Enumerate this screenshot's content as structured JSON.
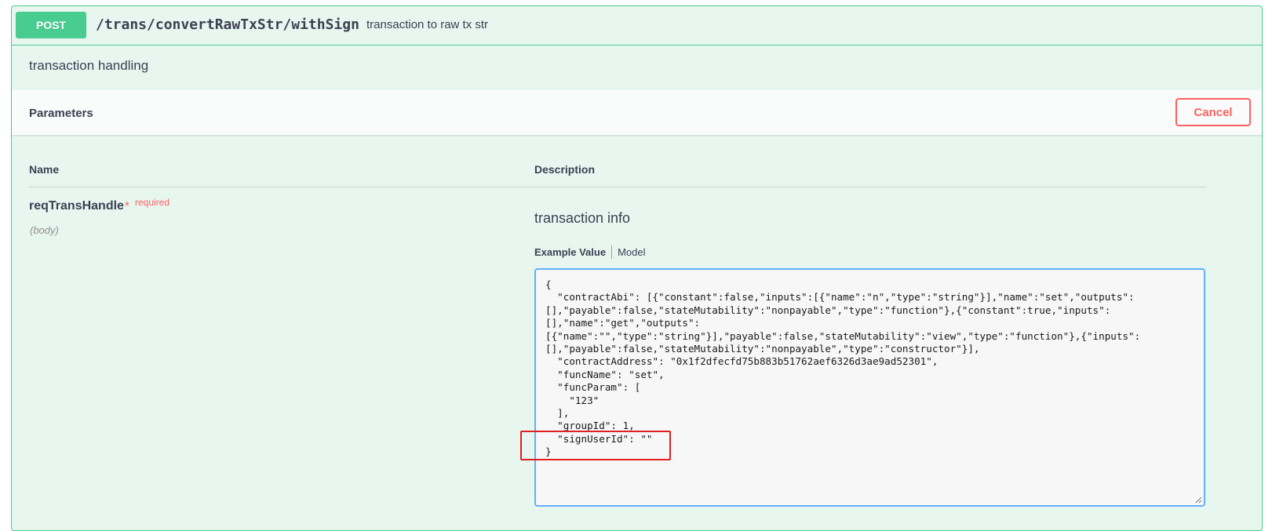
{
  "operation": {
    "method": "POST",
    "path": "/trans/convertRawTxStr/withSign",
    "summary": "transaction to raw tx str",
    "description": "transaction handling"
  },
  "parameters": {
    "title": "Parameters",
    "cancel_label": "Cancel",
    "columns": {
      "name": "Name",
      "description": "Description"
    },
    "param": {
      "name": "reqTransHandle",
      "required_star": "*",
      "required_label": "required",
      "in": "(body)",
      "description": "transaction info"
    },
    "tabs": {
      "example": "Example Value",
      "model": "Model"
    },
    "example_value": "{\n  \"contractAbi\": [{\"constant\":false,\"inputs\":[{\"name\":\"n\",\"type\":\"string\"}],\"name\":\"set\",\"outputs\":\n[],\"payable\":false,\"stateMutability\":\"nonpayable\",\"type\":\"function\"},{\"constant\":true,\"inputs\":\n[],\"name\":\"get\",\"outputs\":\n[{\"name\":\"\",\"type\":\"string\"}],\"payable\":false,\"stateMutability\":\"view\",\"type\":\"function\"},{\"inputs\":\n[],\"payable\":false,\"stateMutability\":\"nonpayable\",\"type\":\"constructor\"}],\n  \"contractAddress\": \"0x1f2dfecfd75b883b51762aef6326d3ae9ad52301\",\n  \"funcName\": \"set\",\n  \"funcParam\": [\n    \"123\"\n  ],\n  \"groupId\": 1,\n  \"signUserId\": \"\"\n}"
  },
  "colors": {
    "post_green": "#49cc90",
    "block_bg": "#e8f6f0",
    "cancel_red": "#ff6060",
    "textarea_border": "#61affe",
    "highlight_red": "#e02020"
  }
}
